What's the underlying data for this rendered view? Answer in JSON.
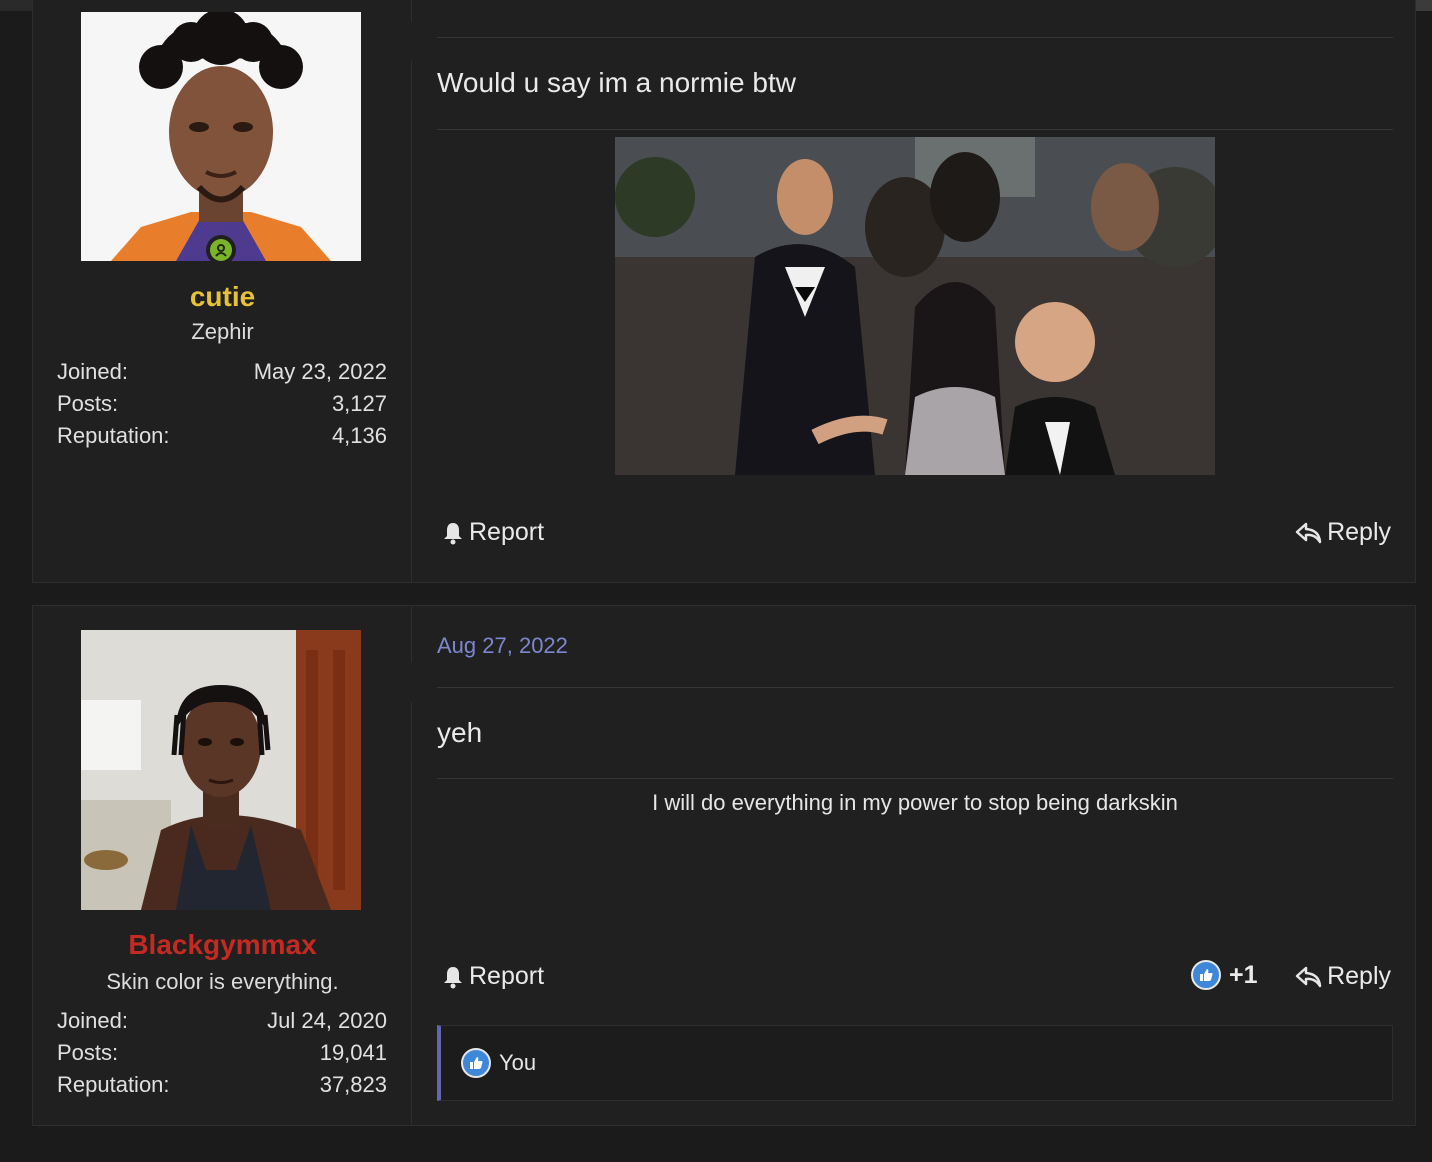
{
  "posts": [
    {
      "username": "cutie",
      "username_color": "#e6c23a",
      "user_title": "Zephir",
      "online": true,
      "stats": [
        {
          "label": "Joined:",
          "value": "May 23, 2022"
        },
        {
          "label": "Posts:",
          "value": "3,127"
        },
        {
          "label": "Reputation:",
          "value": "4,136"
        }
      ],
      "message": "Would u say im a normie btw",
      "has_image": true,
      "actions": {
        "report": "Report",
        "reply": "Reply"
      }
    },
    {
      "username": "Blackgymmax",
      "username_color": "#c42a22",
      "user_title": "Skin color is everything.",
      "date": "Aug 27, 2022",
      "stats": [
        {
          "label": "Joined:",
          "value": "Jul 24, 2020"
        },
        {
          "label": "Posts:",
          "value": "19,041"
        },
        {
          "label": "Reputation:",
          "value": "37,823"
        }
      ],
      "message": "yeh",
      "signature": "I will do everything in my power to stop being darkskin",
      "actions": {
        "report": "Report",
        "reaction_count": "+1",
        "reply": "Reply"
      },
      "reactions_by": "You"
    }
  ],
  "icons": {
    "report": "bell-icon",
    "reply": "reply-arrow-icon",
    "like": "thumbs-up-icon",
    "online": "user-online-icon"
  }
}
